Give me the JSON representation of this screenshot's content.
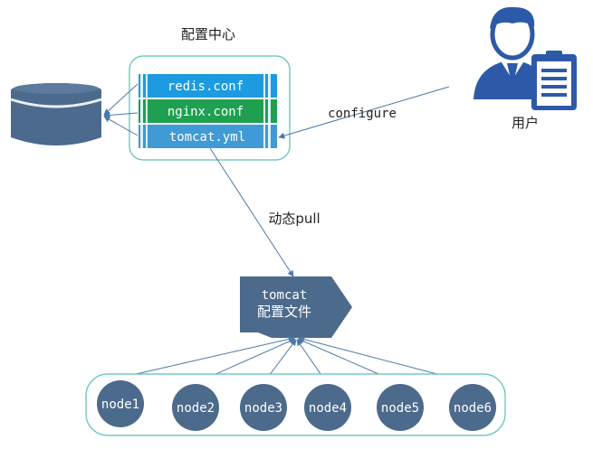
{
  "config_center": {
    "title": "配置中心",
    "files": [
      "redis.conf",
      "nginx.conf",
      "tomcat.yml"
    ]
  },
  "user": {
    "label": "用户"
  },
  "edge_configure": "configure",
  "edge_pull": "动态pull",
  "tomcat_config": {
    "line1": "tomcat",
    "line2": "配置文件"
  },
  "nodes": [
    "node1",
    "node2",
    "node3",
    "node4",
    "node5",
    "node6"
  ],
  "colors": {
    "redis_bar": "#1d9be0",
    "nginx_bar": "#1fa050",
    "tomcat_bar": "#3f9ad6",
    "stripe": "#dff0fa",
    "panel_border": "#58c2b1",
    "steel": "#4c6a8c",
    "arrow": "#4a78a8",
    "user_blue": "#2d5aa8"
  }
}
